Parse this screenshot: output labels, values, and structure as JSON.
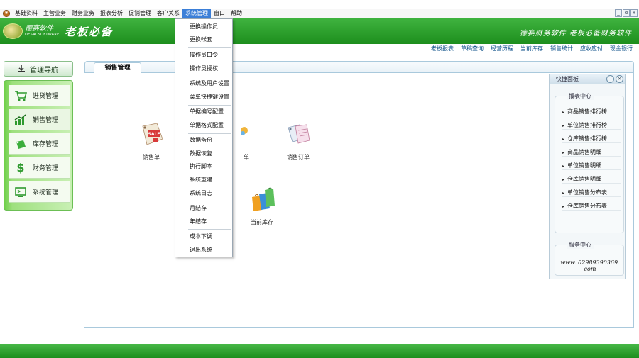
{
  "menubar": {
    "items": [
      "基础资料",
      "主营业务",
      "财务业务",
      "报表分析",
      "促销管理",
      "客户关系",
      "系统管理",
      "窗口",
      "帮助"
    ],
    "active_index": 6,
    "window_controls": [
      "_",
      "ɑ",
      "x"
    ]
  },
  "banner": {
    "logo_cn": "德赛软件",
    "logo_en": "DESAI SOFTWARE",
    "slogan_left": "老板必备",
    "slogan_right": "德赛财务软件  老板必备财务软件"
  },
  "quicklinks": [
    "老板报表",
    "草稿查询",
    "经营历程",
    "当前库存",
    "销售统计",
    "应收应付",
    "现金银行"
  ],
  "nav": {
    "title": "管理导航",
    "items": [
      {
        "label": "进货管理",
        "icon": "cart-icon"
      },
      {
        "label": "销售管理",
        "icon": "chart-up-icon"
      },
      {
        "label": "库存管理",
        "icon": "bag-icon"
      },
      {
        "label": "财务管理",
        "icon": "dollar-icon"
      },
      {
        "label": "系统管理",
        "icon": "monitor-icon"
      }
    ],
    "active_index": 1
  },
  "main": {
    "tab_label": "销售管理",
    "shortcuts": [
      {
        "label": "销售单",
        "icon": "sale-tag-icon"
      },
      {
        "label": "单",
        "icon": "return-icon"
      },
      {
        "label": "销售订单",
        "icon": "order-tags-icon"
      },
      {
        "label": "当前库存",
        "icon": "shopping-bags-icon"
      }
    ]
  },
  "dropdown": {
    "items": [
      "更换操作员",
      "更换帐套",
      "操作员口令",
      "操作员授权",
      "系统及用户设置",
      "菜单快捷键设置",
      "单据编号配置",
      "单据格式配置",
      "数据备份",
      "数据恢复",
      "执行脚本",
      "系统重建",
      "系统日志",
      "月结存",
      "年结存",
      "成本下调",
      "退出系统"
    ]
  },
  "quick_panel": {
    "title": "快捷面板",
    "report_center_title": "报表中心",
    "report_links": [
      "商品销售排行榜",
      "单位销售排行榜",
      "仓库销售排行榜",
      "商品销售明细",
      "单位销售明细",
      "仓库销售明细",
      "单位销售分布表",
      "仓库销售分布表"
    ],
    "service_center_title": "服务中心",
    "service_phone": "www. 02989390369. com"
  },
  "colors": {
    "brand_green": "#2aa02a",
    "menu_highlight": "#3b7fd8",
    "link_blue": "#0b4f88"
  }
}
